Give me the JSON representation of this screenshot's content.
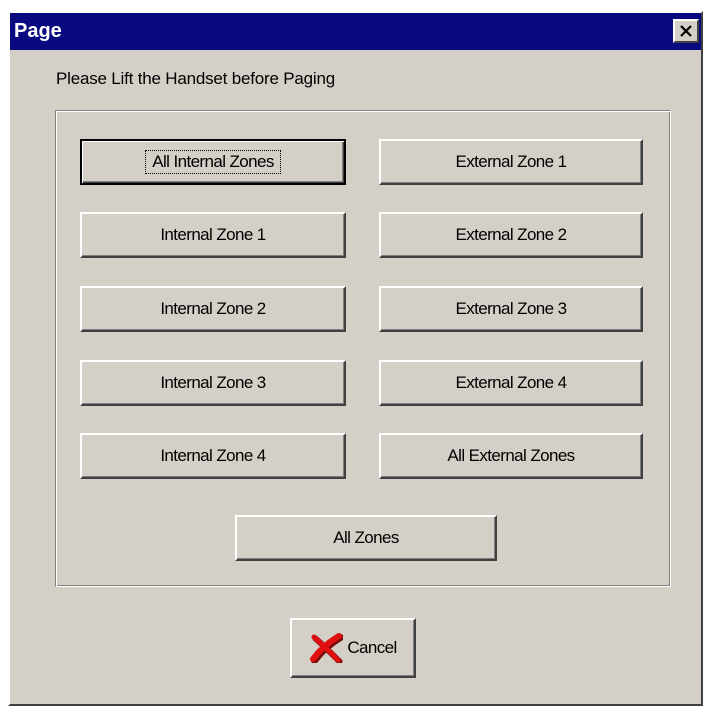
{
  "window": {
    "title": "Page",
    "close_label": "Close"
  },
  "instruction": "Please Lift the Handset before Paging",
  "buttons": {
    "all_internal": "All Internal Zones",
    "internal_1": "Internal Zone 1",
    "internal_2": "Internal Zone 2",
    "internal_3": "Internal Zone 3",
    "internal_4": "Internal Zone 4",
    "external_1": "External Zone 1",
    "external_2": "External Zone 2",
    "external_3": "External Zone 3",
    "external_4": "External Zone 4",
    "all_external": "All External Zones",
    "all_zones": "All Zones",
    "cancel": "Cancel"
  },
  "icons": {
    "close": "close-x-icon",
    "cancel": "red-x-icon"
  },
  "colors": {
    "titlebar": "#0a0a80",
    "face": "#d4d0c8",
    "cancel_icon": "#e01010"
  }
}
